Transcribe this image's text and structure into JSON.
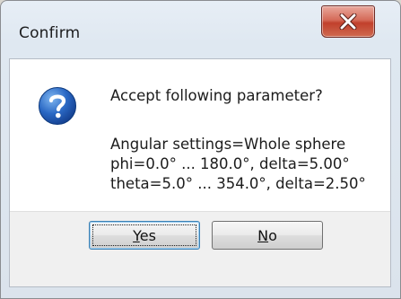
{
  "window": {
    "title": "Confirm"
  },
  "dialog": {
    "question": "Accept following parameter?",
    "lines": [
      "Angular settings=Whole sphere",
      "phi=0.0° ... 180.0°, delta=5.00°",
      "theta=5.0° ... 354.0°, delta=2.50°"
    ]
  },
  "buttons": {
    "yes": {
      "mnemonic": "Y",
      "rest": "es"
    },
    "no": {
      "mnemonic": "N",
      "rest": "o"
    }
  },
  "icons": {
    "close": "close-icon",
    "question": "question-icon"
  },
  "colors": {
    "close_button": "#c1402c",
    "question_icon": "#1f5fb5"
  }
}
